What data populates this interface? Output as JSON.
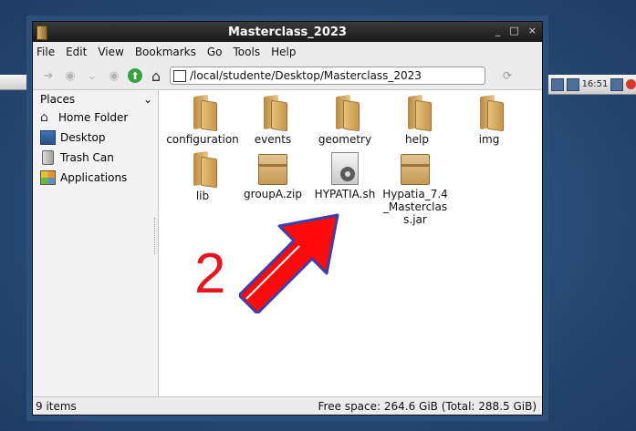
{
  "window": {
    "title": "Masterclass_2023",
    "controls": [
      "_",
      "□",
      "×"
    ]
  },
  "menubar": {
    "items": [
      "File",
      "Edit",
      "View",
      "Bookmarks",
      "Go",
      "Tools",
      "Help"
    ]
  },
  "toolbar": {
    "address": "/local/studente/Desktop/Masterclass_2023"
  },
  "sidebar": {
    "header": "Places",
    "items": [
      {
        "label": "Home Folder",
        "icon": "home-icon"
      },
      {
        "label": "Desktop",
        "icon": "desktop-icon"
      },
      {
        "label": "Trash Can",
        "icon": "trash-icon"
      },
      {
        "label": "Applications",
        "icon": "applications-icon"
      }
    ]
  },
  "files": [
    {
      "name": "configuration",
      "type": "folder"
    },
    {
      "name": "events",
      "type": "folder"
    },
    {
      "name": "geometry",
      "type": "folder"
    },
    {
      "name": "help",
      "type": "folder"
    },
    {
      "name": "img",
      "type": "folder"
    },
    {
      "name": "lib",
      "type": "folder"
    },
    {
      "name": "groupA.zip",
      "type": "archive"
    },
    {
      "name": "HYPATIA.sh",
      "type": "script"
    },
    {
      "name": "Hypatia_7.4_Masterclass.jar",
      "type": "archive"
    }
  ],
  "statusbar": {
    "items_count": "9 items",
    "free_space": "Free space: 264.6 GiB (Total: 288.5 GiB)"
  },
  "panel": {
    "clock": "16:51"
  },
  "annotation": {
    "number": "2",
    "color": "#e8141e"
  }
}
